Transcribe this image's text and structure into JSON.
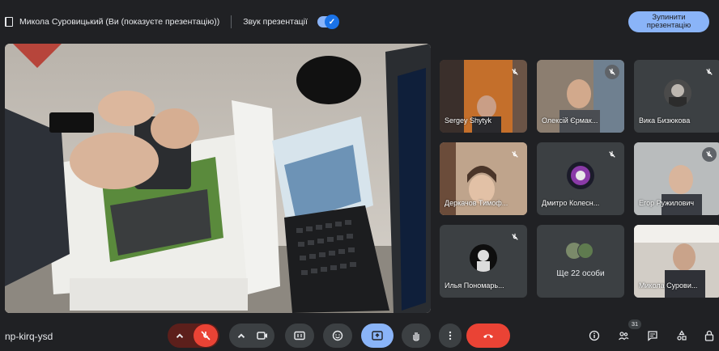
{
  "topbar": {
    "presenter_text": "Микола Суровицький (Ви (показуєте презентацію))",
    "sound_label": "Звук презентації",
    "stop_label_line1": "Зупинити",
    "stop_label_line2": "презентацію"
  },
  "participants": [
    {
      "name": "Sergey Shytyk",
      "muted": true
    },
    {
      "name": "Олексій Єрмак...",
      "muted": true
    },
    {
      "name": "Вика Бизюкова",
      "muted": true
    },
    {
      "name": "Деркачов Тимоф...",
      "muted": true
    },
    {
      "name": "Дмитро Колесн...",
      "muted": true
    },
    {
      "name": "Егор Ружилович",
      "muted": true
    },
    {
      "name": "Илья Пономарь...",
      "muted": true
    },
    {
      "name": "Ще 22 особи",
      "muted": false
    },
    {
      "name": "Микола Сурови...",
      "muted": false
    }
  ],
  "bottombar": {
    "meeting_code": "np-kirq-ysd",
    "participant_count": "31"
  },
  "icons": {
    "mic": "mic-off-icon",
    "camera": "camera-icon",
    "captions": "captions-icon",
    "emoji": "emoji-icon",
    "present": "present-icon",
    "hand": "raise-hand-icon",
    "more": "more-options-icon",
    "end": "end-call-icon",
    "info": "info-icon",
    "people": "people-icon",
    "chat": "chat-icon",
    "activities": "activities-icon",
    "lock": "host-controls-icon"
  },
  "colors": {
    "background": "#202124",
    "accent": "#8ab4f8",
    "end_call": "#ea4335",
    "mic_off": "#ea4335",
    "present_active": "#8ab4f8"
  }
}
